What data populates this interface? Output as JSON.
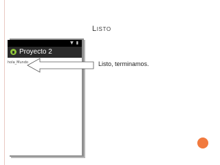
{
  "slide": {
    "title": "Listo",
    "callout_text": "Listo, terminamos."
  },
  "emulator": {
    "app_title": "Proyecto 2",
    "content_text": "hola_Mundo",
    "status_icons": "▼ ▮"
  },
  "colors": {
    "accent_orange": "#f17a3e",
    "action_bar": "#2b2b2b",
    "android_green": "#8fc53a",
    "rule": "#e9c9c2"
  }
}
